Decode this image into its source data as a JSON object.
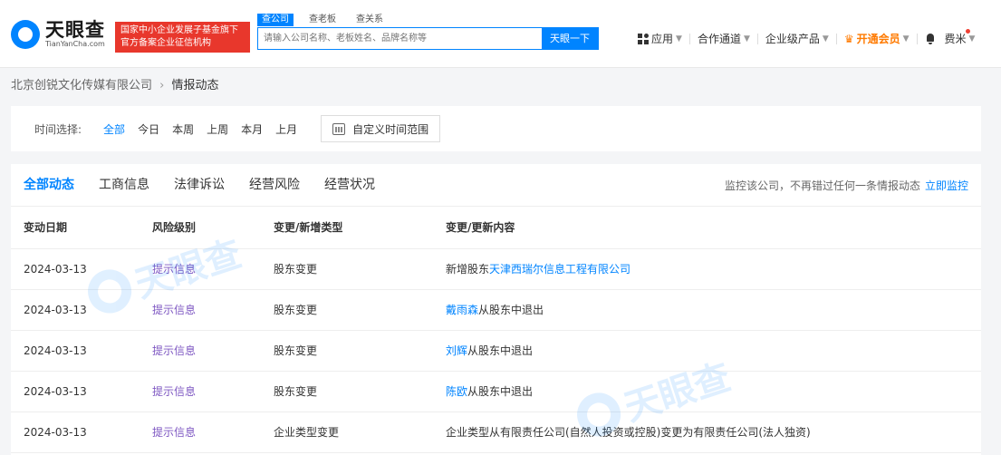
{
  "brand": {
    "name_cn": "天眼查",
    "name_en": "TianYanCha.com",
    "badge_line1": "国家中小企业发展子基金旗下",
    "badge_line2": "官方备案企业征信机构"
  },
  "search": {
    "tabs": [
      {
        "label": "查公司",
        "active": true
      },
      {
        "label": "查老板",
        "active": false
      },
      {
        "label": "查关系",
        "active": false
      }
    ],
    "placeholder": "请输入公司名称、老板姓名、品牌名称等",
    "button": "天眼一下"
  },
  "topnav": {
    "apps": "应用",
    "channel": "合作通道",
    "enterprise": "企业级产品",
    "vip": "开通会员",
    "user": "费米"
  },
  "breadcrumb": {
    "company": "北京创锐文化传媒有限公司",
    "separator": "›",
    "current": "情报动态"
  },
  "filter": {
    "label": "时间选择:",
    "options": [
      "全部",
      "今日",
      "本周",
      "上周",
      "本月",
      "上月"
    ],
    "active_index": 0,
    "custom": "自定义时间范围"
  },
  "tabs": [
    "全部动态",
    "工商信息",
    "法律诉讼",
    "经营风险",
    "经营状况"
  ],
  "active_tab": 0,
  "monitor": {
    "text": "监控该公司，不再错过任何一条情报动态",
    "link": "立即监控"
  },
  "table": {
    "headers": [
      "变动日期",
      "风险级别",
      "变更/新增类型",
      "变更/更新内容"
    ],
    "rows": [
      {
        "date": "2024-03-13",
        "risk": "提示信息",
        "type": "股东变更",
        "pre": "新增股东",
        "link": "天津西瑞尔信息工程有限公司",
        "post": ""
      },
      {
        "date": "2024-03-13",
        "risk": "提示信息",
        "type": "股东变更",
        "pre": "",
        "link": "戴雨森",
        "post": "从股东中退出"
      },
      {
        "date": "2024-03-13",
        "risk": "提示信息",
        "type": "股东变更",
        "pre": "",
        "link": "刘辉",
        "post": "从股东中退出"
      },
      {
        "date": "2024-03-13",
        "risk": "提示信息",
        "type": "股东变更",
        "pre": "",
        "link": "陈欧",
        "post": "从股东中退出"
      },
      {
        "date": "2024-03-13",
        "risk": "提示信息",
        "type": "企业类型变更",
        "pre": "企业类型从有限责任公司(自然人投资或控股)变更为有限责任公司(法人独资)",
        "link": "",
        "post": ""
      }
    ]
  },
  "watermark": {
    "text": "天眼查"
  },
  "colors": {
    "accent": "#0084ff",
    "badge": "#e8372c",
    "vip": "#ff7a00",
    "risk": "#7e57c2"
  }
}
